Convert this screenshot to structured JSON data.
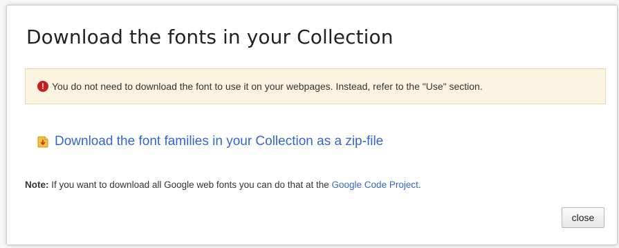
{
  "dialog": {
    "title": "Download the fonts in your Collection",
    "warning": {
      "icon": "error-icon",
      "text": "You do not need to download the font to use it on your webpages. Instead, refer to the \"Use\" section."
    },
    "download": {
      "icon": "zip-file-icon",
      "link_text": "Download the font families in your Collection as a zip-file"
    },
    "note": {
      "label": "Note:",
      "text": " If you want to download all Google web fonts you can do that at the ",
      "link_text": "Google Code Project",
      "suffix": "."
    },
    "close_label": "close"
  },
  "colors": {
    "link": "#3366cc",
    "warning_background": "#fcf3e1",
    "warning_border": "#ead7b0",
    "error_icon": "#c81e1e",
    "title_text": "#222222"
  }
}
